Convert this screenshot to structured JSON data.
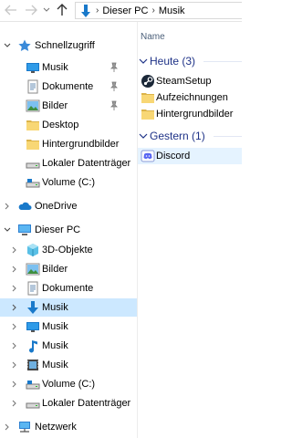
{
  "toolbar": {
    "back_icon": "arrow-left",
    "forward_icon": "arrow-right",
    "recent_icon": "chevron-down",
    "up_icon": "arrow-up"
  },
  "address": {
    "location_icon": "music-folder-arrow",
    "crumbs": [
      "Dieser PC",
      "Musik"
    ],
    "separator": "›"
  },
  "nav": {
    "quick_access": {
      "label": "Schnellzugriff",
      "items": [
        {
          "label": "Musik",
          "icon": "monitor-folder",
          "pinned": true
        },
        {
          "label": "Dokumente",
          "icon": "documents-folder",
          "pinned": true
        },
        {
          "label": "Bilder",
          "icon": "pictures-folder",
          "pinned": true
        },
        {
          "label": "Desktop",
          "icon": "yellow-folder",
          "pinned": false
        },
        {
          "label": "Hintergrundbilder",
          "icon": "yellow-folder",
          "pinned": false
        },
        {
          "label": "Lokaler Datenträger",
          "icon": "drive",
          "pinned": false
        },
        {
          "label": "Volume (C:)",
          "icon": "drive",
          "pinned": false
        }
      ]
    },
    "onedrive": {
      "label": "OneDrive"
    },
    "this_pc": {
      "label": "Dieser PC",
      "items": [
        {
          "label": "3D-Objekte",
          "icon": "3d-objects-folder"
        },
        {
          "label": "Bilder",
          "icon": "pictures-folder"
        },
        {
          "label": "Dokumente",
          "icon": "documents-folder"
        },
        {
          "label": "Musik",
          "icon": "music-download-folder",
          "selected": true
        },
        {
          "label": "Musik",
          "icon": "monitor-folder"
        },
        {
          "label": "Musik",
          "icon": "music-note-folder"
        },
        {
          "label": "Musik",
          "icon": "video-folder"
        },
        {
          "label": "Volume (C:)",
          "icon": "drive"
        },
        {
          "label": "Lokaler Datenträger",
          "icon": "drive"
        }
      ]
    },
    "network": {
      "label": "Netzwerk"
    }
  },
  "content": {
    "column_name": "Name",
    "groups": [
      {
        "title": "Heute (3)",
        "items": [
          {
            "label": "SteamSetup",
            "icon": "steam-app"
          },
          {
            "label": "Aufzeichnungen",
            "icon": "yellow-folder"
          },
          {
            "label": "Hintergrundbilder",
            "icon": "yellow-folder"
          }
        ]
      },
      {
        "title": "Gestern (1)",
        "items": [
          {
            "label": "Discord",
            "icon": "discord-shortcut",
            "selected": true
          }
        ]
      }
    ]
  },
  "colors": {
    "selection": "#cce8ff",
    "hover_selection": "#e5f3ff",
    "group_title": "#1e3287",
    "folder_yellow": "#f8d775",
    "accent_blue": "#1979ca"
  }
}
